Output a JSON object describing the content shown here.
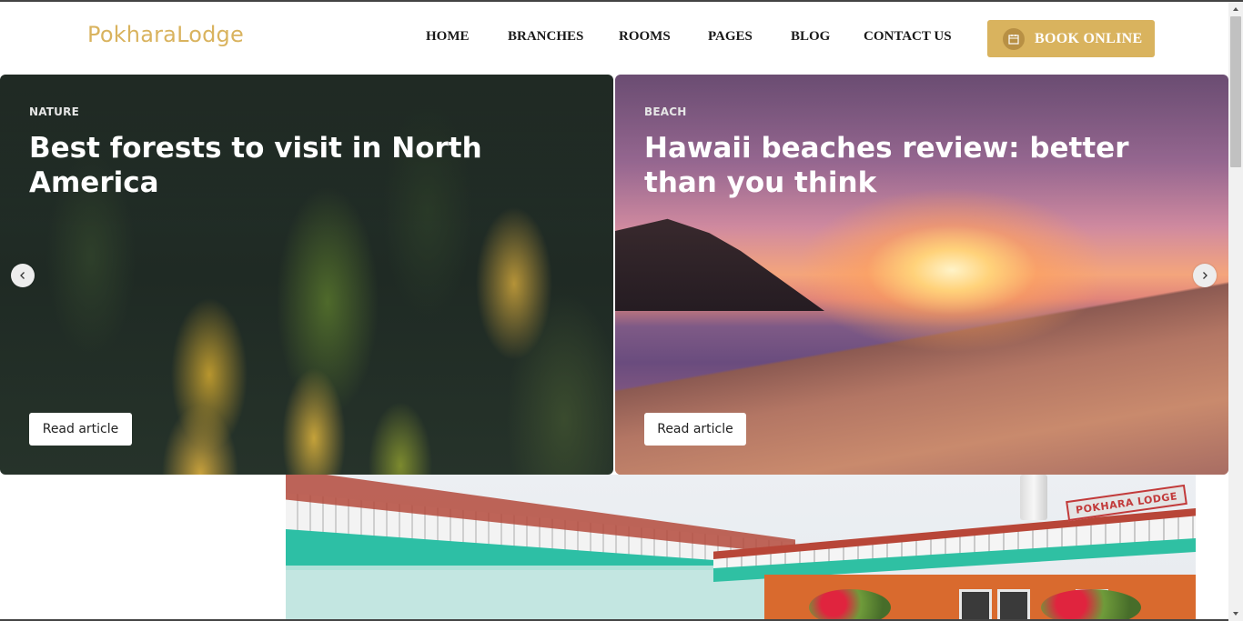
{
  "header": {
    "logo": "PokharaLodge",
    "nav": [
      "HOME",
      "BRANCHES",
      "ROOMS",
      "PAGES",
      "BLOG",
      "CONTACT US"
    ],
    "book_button": "BOOK ONLINE",
    "accent_color": "#d9b35e"
  },
  "slider": {
    "cards": [
      {
        "tag": "NATURE",
        "title": "Best forests to visit in North America",
        "button": "Read article",
        "image": "forest-photo"
      },
      {
        "tag": "BEACH",
        "title": "Hawaii beaches review: better than you think",
        "button": "Read article",
        "image": "beach-sunset-photo"
      }
    ],
    "prev_icon": "chevron-left-icon",
    "next_icon": "chevron-right-icon"
  },
  "hotel_photo": {
    "sign_text": "POKHARA LODGE"
  }
}
